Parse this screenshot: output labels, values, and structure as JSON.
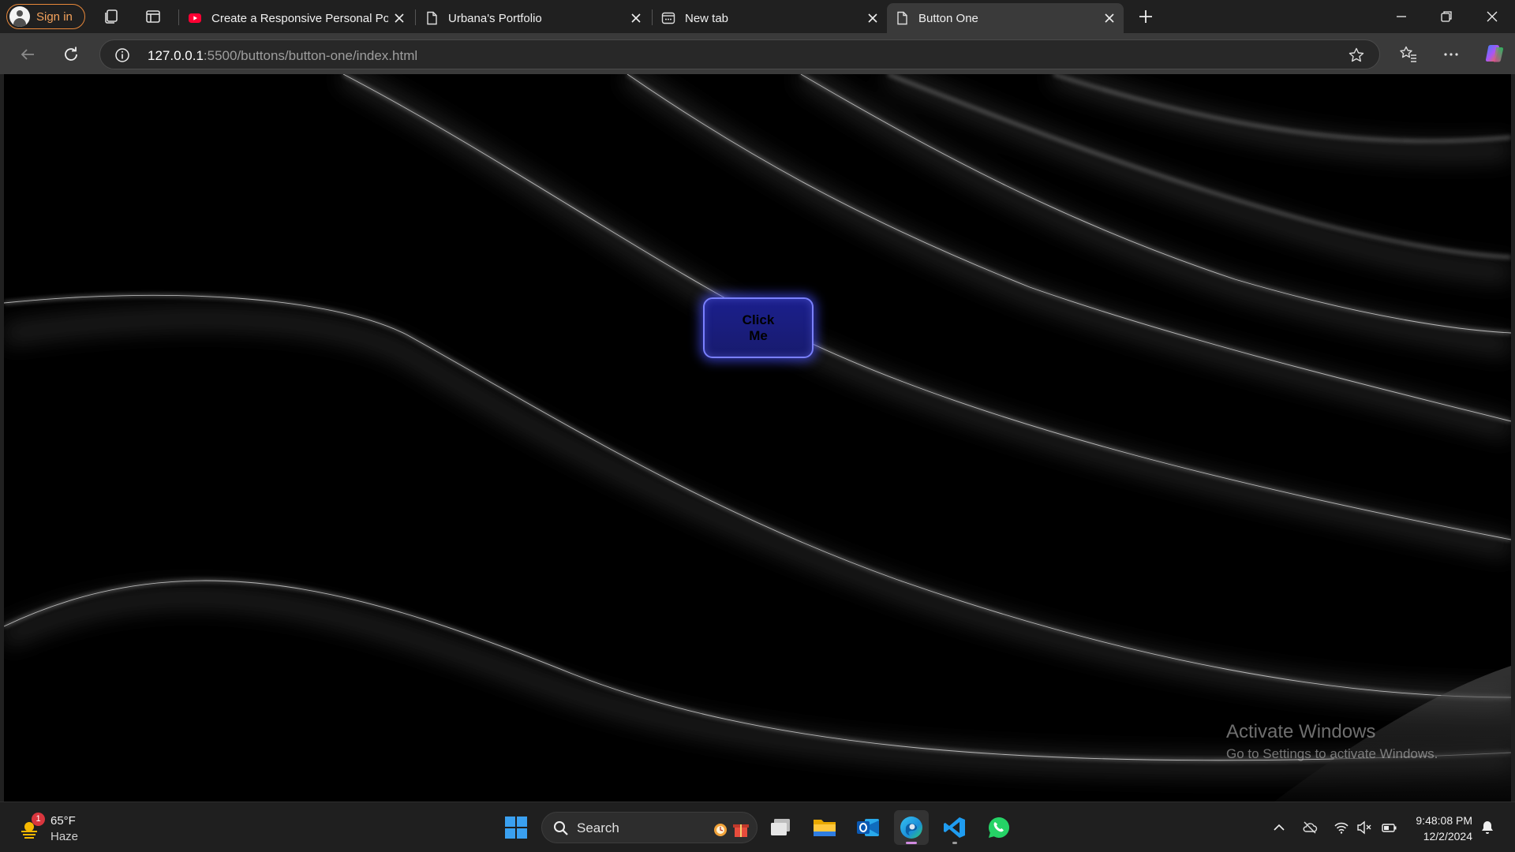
{
  "browser": {
    "signin_label": "Sign in",
    "tabs": [
      {
        "title": "Create a Responsive Personal Portfolio",
        "favicon": "youtube-icon"
      },
      {
        "title": "Urbana's Portfolio",
        "favicon": "page-icon"
      },
      {
        "title": "New tab",
        "favicon": "newtab-icon"
      },
      {
        "title": "Button One",
        "favicon": "page-icon",
        "active": true
      }
    ],
    "address": {
      "host": "127.0.0.1",
      "rest": ":5500/buttons/button-one/index.html"
    }
  },
  "page": {
    "button_label": "Click Me",
    "watermark": {
      "title": "Activate Windows",
      "subtitle": "Go to Settings to activate Windows."
    }
  },
  "taskbar": {
    "weather": {
      "temp": "65°F",
      "condition": "Haze",
      "badge": "1"
    },
    "search_label": "Search",
    "time": "9:48:08 PM",
    "date": "12/2/2024"
  },
  "colors": {
    "button_fill": "#1b1f8c",
    "button_border": "#7a80ff",
    "signin_accent": "#e8883a",
    "page_bg": "#000000"
  }
}
